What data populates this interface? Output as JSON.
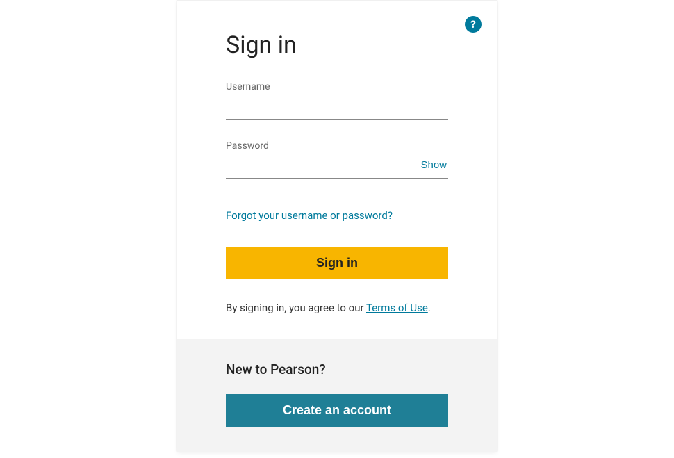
{
  "signin": {
    "title": "Sign in",
    "username_label": "Username",
    "username_value": "",
    "password_label": "Password",
    "password_value": "",
    "show_label": "Show",
    "forgot_link": "Forgot your username or password?",
    "signin_button": "Sign in",
    "terms_prefix": "By signing in, you agree to our ",
    "terms_link": "Terms of Use",
    "terms_suffix": "."
  },
  "signup": {
    "title": "New to Pearson?",
    "create_button": "Create an account"
  },
  "help_icon_glyph": "?"
}
